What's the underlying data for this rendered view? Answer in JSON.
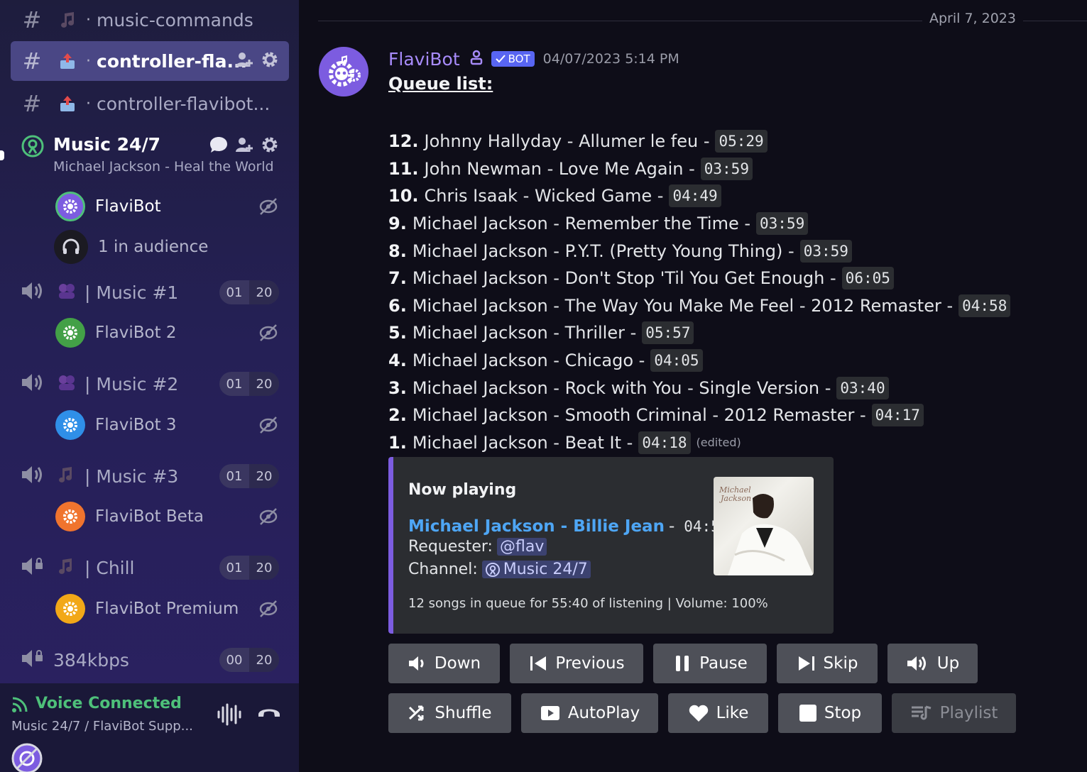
{
  "sidebar": {
    "channels": [
      {
        "name": "music-commands"
      },
      {
        "name": "controller-fla..."
      },
      {
        "name": "controller-flavibot..."
      }
    ],
    "stage": {
      "name": "Music 24/7",
      "subtitle": "Michael Jackson - Heal the World"
    },
    "members": [
      {
        "name": "FlaviBot",
        "color": "#7c5ce0"
      },
      {
        "name": "1 in audience"
      },
      {
        "name": "FlaviBot 2",
        "color": "#43a047"
      },
      {
        "name": "FlaviBot 3",
        "color": "#2f8fe8"
      },
      {
        "name": "FlaviBot Beta",
        "color": "#f0742e"
      },
      {
        "name": "FlaviBot Premium",
        "color": "#f2a818"
      }
    ],
    "voice_channels": [
      {
        "name": "| Music #1",
        "users": "01",
        "limit": "20"
      },
      {
        "name": "| Music #2",
        "users": "01",
        "limit": "20"
      },
      {
        "name": "| Music #3",
        "users": "01",
        "limit": "20"
      },
      {
        "name": "| Chill",
        "users": "01",
        "limit": "20"
      },
      {
        "name": "384kbps",
        "users": "00",
        "limit": "20"
      }
    ]
  },
  "voice_bar": {
    "title": "Voice Connected",
    "subtitle": "Music 24/7 / FlaviBot Supp..."
  },
  "message": {
    "date_divider": "April 7, 2023",
    "author": "FlaviBot",
    "bot_tag": "BOT",
    "timestamp": "04/07/2023 5:14 PM",
    "queue_title": "Queue list:",
    "queue": [
      {
        "num": "12.",
        "title": "Johnny Hallyday - Allumer le feu -",
        "duration": "05:29"
      },
      {
        "num": "11.",
        "title": "John Newman - Love Me Again -",
        "duration": "03:59"
      },
      {
        "num": "10.",
        "title": "Chris Isaak - Wicked Game -",
        "duration": "04:49"
      },
      {
        "num": "9.",
        "title": "Michael Jackson - Remember the Time -",
        "duration": "03:59"
      },
      {
        "num": "8.",
        "title": "Michael Jackson - P.Y.T. (Pretty Young Thing) -",
        "duration": "03:59"
      },
      {
        "num": "7.",
        "title": "Michael Jackson - Don't Stop 'Til You Get Enough -",
        "duration": "06:05"
      },
      {
        "num": "6.",
        "title": "Michael Jackson - The Way You Make Me Feel - 2012 Remaster -",
        "duration": "04:58"
      },
      {
        "num": "5.",
        "title": "Michael Jackson - Thriller -",
        "duration": "05:57"
      },
      {
        "num": "4.",
        "title": "Michael Jackson - Chicago -",
        "duration": "04:05"
      },
      {
        "num": "3.",
        "title": "Michael Jackson - Rock with You - Single Version -",
        "duration": "03:40"
      },
      {
        "num": "2.",
        "title": "Michael Jackson - Smooth Criminal - 2012 Remaster -",
        "duration": "04:17"
      },
      {
        "num": "1.",
        "title": "Michael Jackson - Beat It -",
        "duration": "04:18"
      }
    ],
    "edited": "(edited)",
    "embed": {
      "title": "Now playing",
      "track": "Michael Jackson - Billie Jean",
      "sep": "-",
      "duration": "04:53",
      "requester_label": "Requester:",
      "requester": "@flav",
      "channel_label": "Channel:",
      "channel": "Music 24/7",
      "footer": "12 songs in queue for 55:40 of listening | Volume: 100%"
    },
    "buttons_row1": [
      "Down",
      "Previous",
      "Pause",
      "Skip",
      "Up"
    ],
    "buttons_row2": [
      "Shuffle",
      "AutoPlay",
      "Like",
      "Stop",
      "Playlist"
    ]
  },
  "colors": {
    "accent": "#7c5ce0",
    "link": "#4ea6f5",
    "voice_connected": "#4ec07a",
    "bot_tag": "#5865f2"
  }
}
